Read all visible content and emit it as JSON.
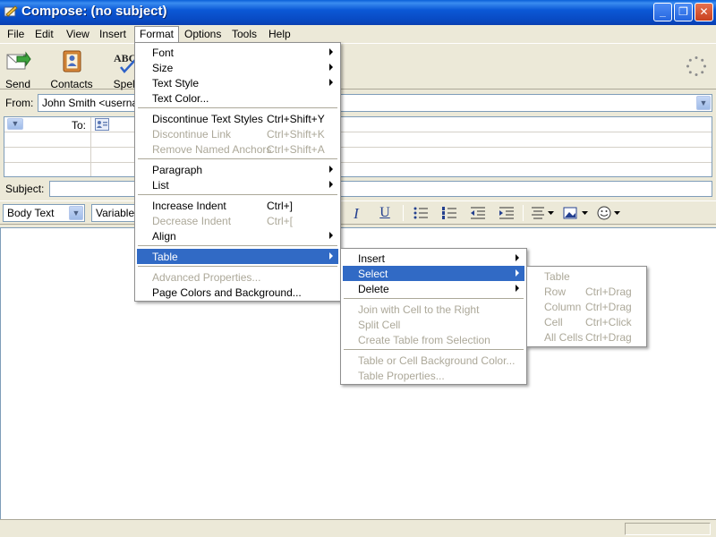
{
  "window": {
    "title": "Compose: (no subject)",
    "min_glyph": "_",
    "max_glyph": "❐",
    "close_glyph": "✕"
  },
  "menubar": [
    "File",
    "Edit",
    "View",
    "Insert",
    "Format",
    "Options",
    "Tools",
    "Help"
  ],
  "toolbar": {
    "send": "Send",
    "contacts": "Contacts",
    "spell": "Spell",
    "spell_icon_text": "ABC"
  },
  "address": {
    "from_label": "From:",
    "from_value": "John Smith <usernam",
    "to_label": "To:"
  },
  "subject": {
    "label": "Subject:",
    "value": ""
  },
  "format_bar": {
    "paragraph_style": "Body Text",
    "font": "Variable",
    "italic": "I",
    "underline": "U"
  },
  "format_menu": {
    "items": [
      {
        "label": "Font",
        "shortcut": "",
        "submenu": true,
        "disabled": false
      },
      {
        "label": "Size",
        "shortcut": "",
        "submenu": true,
        "disabled": false
      },
      {
        "label": "Text Style",
        "shortcut": "",
        "submenu": true,
        "disabled": false
      },
      {
        "label": "Text Color...",
        "shortcut": "",
        "submenu": false,
        "disabled": false
      },
      {
        "label": "Discontinue Text Styles",
        "shortcut": "Ctrl+Shift+Y",
        "submenu": false,
        "disabled": false
      },
      {
        "label": "Discontinue Link",
        "shortcut": "Ctrl+Shift+K",
        "submenu": false,
        "disabled": true
      },
      {
        "label": "Remove Named Anchors",
        "shortcut": "Ctrl+Shift+A",
        "submenu": false,
        "disabled": true
      },
      {
        "label": "Paragraph",
        "shortcut": "",
        "submenu": true,
        "disabled": false
      },
      {
        "label": "List",
        "shortcut": "",
        "submenu": true,
        "disabled": false
      },
      {
        "label": "Increase Indent",
        "shortcut": "Ctrl+]",
        "submenu": false,
        "disabled": false
      },
      {
        "label": "Decrease Indent",
        "shortcut": "Ctrl+[",
        "submenu": false,
        "disabled": true
      },
      {
        "label": "Align",
        "shortcut": "",
        "submenu": true,
        "disabled": false
      },
      {
        "label": "Table",
        "shortcut": "",
        "submenu": true,
        "disabled": false,
        "highlighted": true
      },
      {
        "label": "Advanced Properties...",
        "shortcut": "",
        "submenu": false,
        "disabled": true
      },
      {
        "label": "Page Colors and Background...",
        "shortcut": "",
        "submenu": false,
        "disabled": false
      }
    ]
  },
  "table_menu": {
    "items": [
      {
        "label": "Insert",
        "submenu": true,
        "disabled": false
      },
      {
        "label": "Select",
        "submenu": true,
        "disabled": false,
        "highlighted": true
      },
      {
        "label": "Delete",
        "submenu": true,
        "disabled": false
      },
      {
        "label": "Join with Cell to the Right",
        "submenu": false,
        "disabled": true
      },
      {
        "label": "Split Cell",
        "submenu": false,
        "disabled": true
      },
      {
        "label": "Create Table from Selection",
        "submenu": false,
        "disabled": true
      },
      {
        "label": "Table or Cell Background Color...",
        "submenu": false,
        "disabled": true
      },
      {
        "label": "Table Properties...",
        "submenu": false,
        "disabled": true
      }
    ]
  },
  "select_menu": {
    "items": [
      {
        "label": "Table",
        "shortcut": ""
      },
      {
        "label": "Row",
        "shortcut": "Ctrl+Drag"
      },
      {
        "label": "Column",
        "shortcut": "Ctrl+Drag"
      },
      {
        "label": "Cell",
        "shortcut": "Ctrl+Click"
      },
      {
        "label": "All Cells",
        "shortcut": "Ctrl+Drag"
      }
    ]
  },
  "colors": {
    "menu_highlight": "#316ac5",
    "disabled_text": "#aca899",
    "titlebar": "#0b58d6"
  }
}
